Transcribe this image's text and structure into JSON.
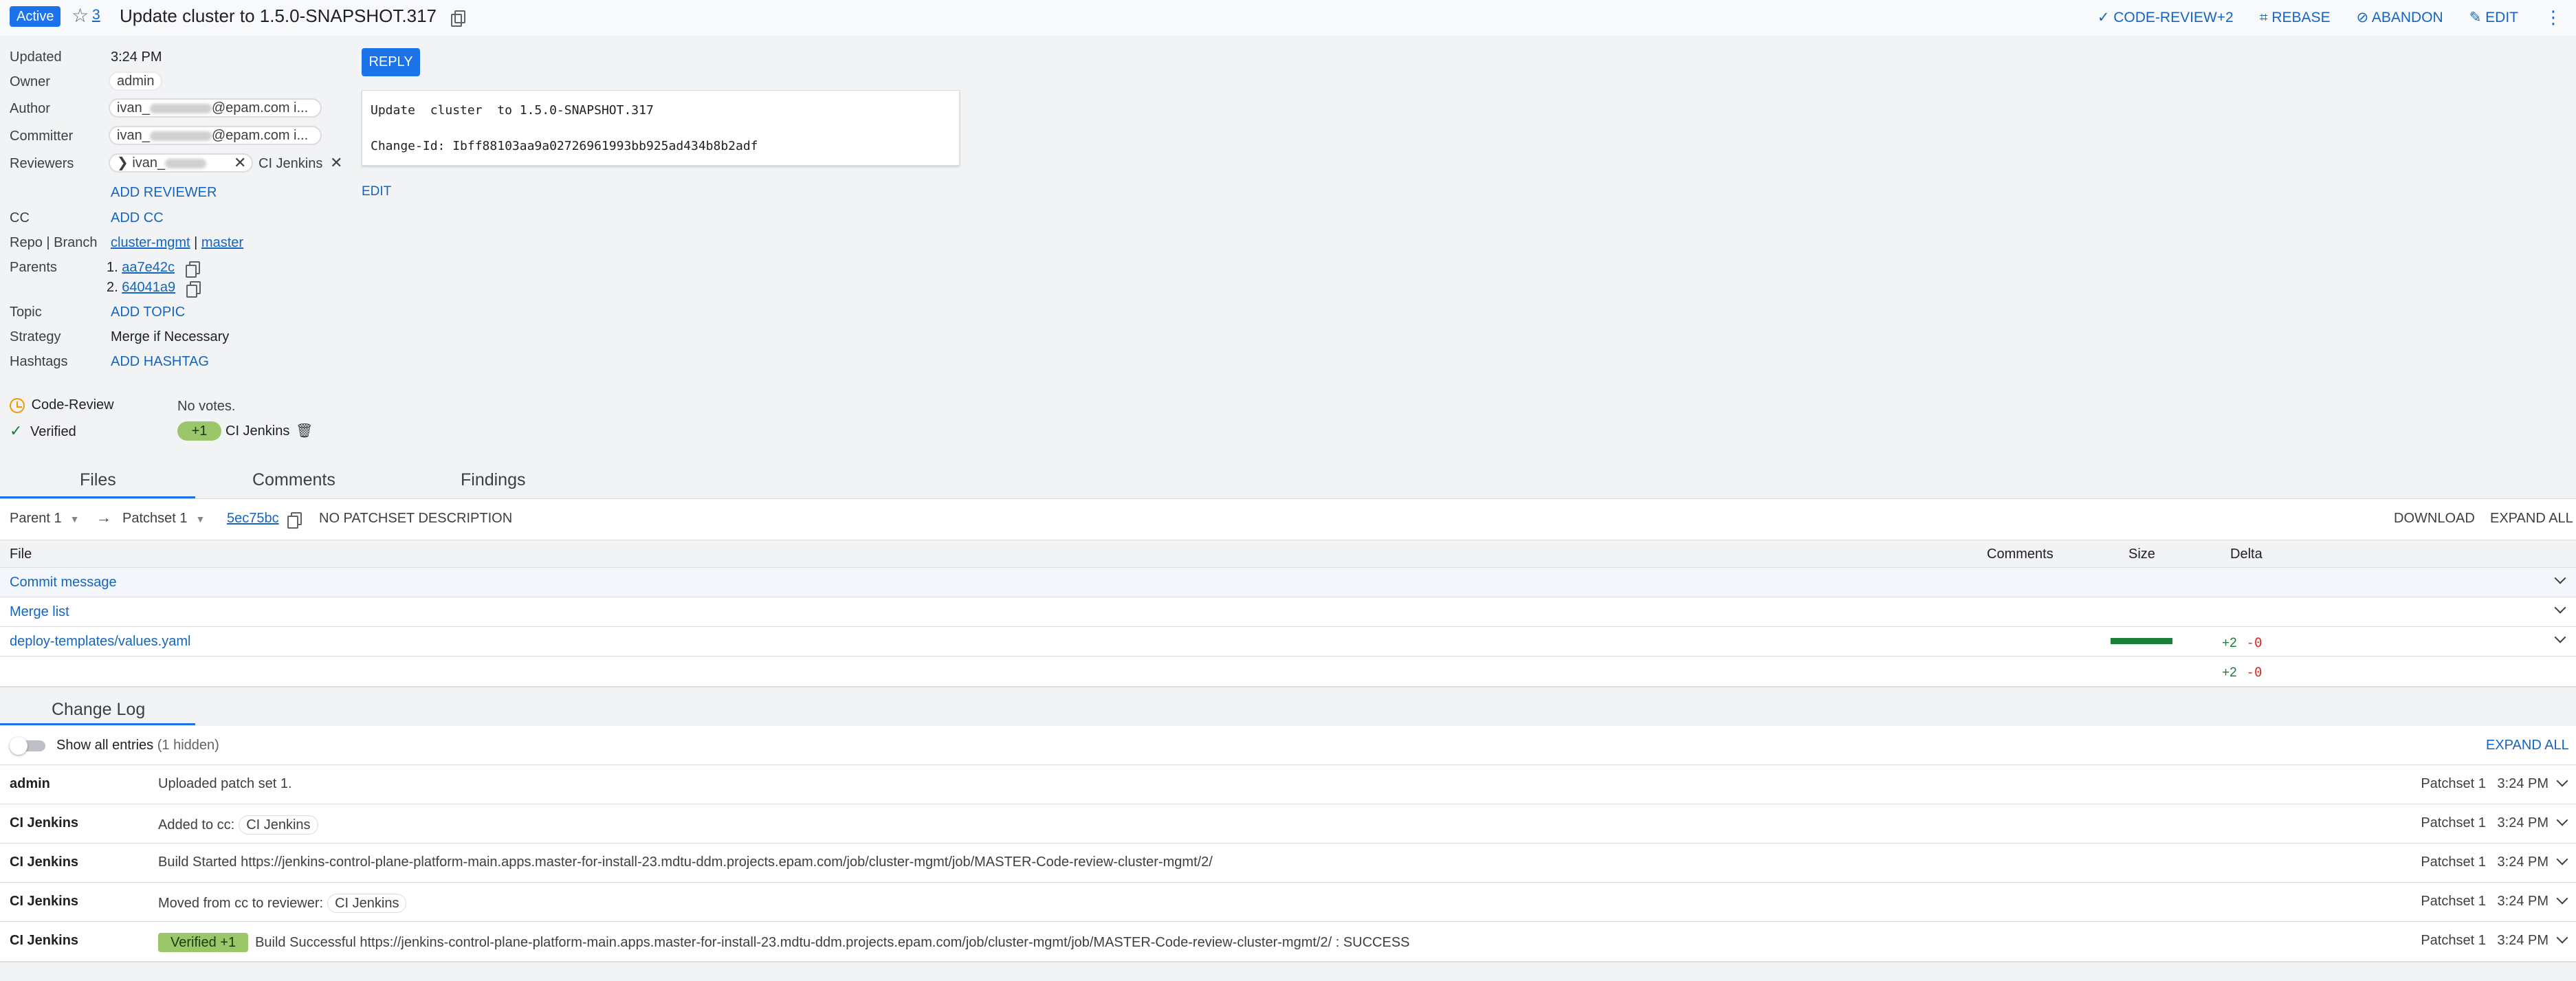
{
  "header": {
    "status": "Active",
    "star_count": "3",
    "title": "Update cluster to 1.5.0-SNAPSHOT.317",
    "actions": {
      "code_review": "CODE-REVIEW+2",
      "rebase": "REBASE",
      "abandon": "ABANDON",
      "edit": "EDIT"
    }
  },
  "meta": {
    "updated_label": "Updated",
    "updated_value": "3:24 PM",
    "owner_label": "Owner",
    "owner_value": "admin",
    "author_label": "Author",
    "author_prefix": "ivan_",
    "author_suffix": "@epam.com i...",
    "committer_label": "Committer",
    "committer_prefix": "ivan_",
    "committer_suffix": "@epam.com i...",
    "reviewers_label": "Reviewers",
    "reviewer1_prefix": "ivan_",
    "reviewer2": "CI Jenkins",
    "add_reviewer": "ADD REVIEWER",
    "cc_label": "CC",
    "add_cc": "ADD CC",
    "repo_label": "Repo | Branch",
    "repo": "cluster-mgmt",
    "branch_sep": "|",
    "branch": "master",
    "parents_label": "Parents",
    "parent1_num": "1.",
    "parent1": "aa7e42c",
    "parent2_num": "2.",
    "parent2": "64041a9",
    "topic_label": "Topic",
    "add_topic": "ADD TOPIC",
    "strategy_label": "Strategy",
    "strategy_value": "Merge if Necessary",
    "hashtags_label": "Hashtags",
    "add_hashtag": "ADD HASHTAG"
  },
  "labels": {
    "code_review_label": "Code-Review",
    "code_review_value": "No votes.",
    "verified_label": "Verified",
    "verified_badge": "+1",
    "verified_by": "CI Jenkins"
  },
  "commit": {
    "reply_button": "REPLY",
    "message": "Update  cluster  to 1.5.0-SNAPSHOT.317\n\nChange-Id: Ibff88103aa9a02726961993bb925ad434b8b2adf",
    "edit_link": "EDIT"
  },
  "tabs": [
    "Files",
    "Comments",
    "Findings"
  ],
  "files_bar": {
    "parent_select": "Parent 1",
    "arrow": "→",
    "patchset_select": "Patchset 1",
    "commit_hash": "5ec75bc",
    "description": "NO PATCHSET DESCRIPTION",
    "download": "DOWNLOAD",
    "expand_all": "EXPAND ALL"
  },
  "file_table": {
    "headers": {
      "file": "File",
      "comments": "Comments",
      "size": "Size",
      "delta": "Delta"
    },
    "rows": [
      {
        "name": "Commit message"
      },
      {
        "name": "Merge list"
      },
      {
        "name": "deploy-templates/values.yaml",
        "size_fill": 1.0,
        "added": "+2",
        "removed": "-0"
      }
    ],
    "total_added": "+2",
    "total_removed": "-0"
  },
  "changelog": {
    "tab": "Change Log",
    "show_all_label": "Show all entries",
    "hidden_count": "(1 hidden)",
    "expand_all": "EXPAND ALL",
    "entries": [
      {
        "author": "admin",
        "message": "Uploaded patch set 1.",
        "patchset": "Patchset 1",
        "time": "3:24 PM"
      },
      {
        "author": "CI Jenkins",
        "message": "Added to cc:",
        "chip": "CI Jenkins",
        "patchset": "Patchset 1",
        "time": "3:24 PM"
      },
      {
        "author": "CI Jenkins",
        "message": "Build Started https://jenkins-control-plane-platform-main.apps.master-for-install-23.mdtu-ddm.projects.epam.com/job/cluster-mgmt/job/MASTER-Code-review-cluster-mgmt/2/",
        "patchset": "Patchset 1",
        "time": "3:24 PM"
      },
      {
        "author": "CI Jenkins",
        "message": "Moved from cc to reviewer:",
        "chip": "CI Jenkins",
        "patchset": "Patchset 1",
        "time": "3:24 PM"
      },
      {
        "author": "CI Jenkins",
        "badge": "Verified +1",
        "message": "Build Successful https://jenkins-control-plane-platform-main.apps.master-for-install-23.mdtu-ddm.projects.epam.com/job/cluster-mgmt/job/MASTER-Code-review-cluster-mgmt/2/ : SUCCESS",
        "patchset": "Patchset 1",
        "time": "3:24 PM"
      }
    ]
  }
}
